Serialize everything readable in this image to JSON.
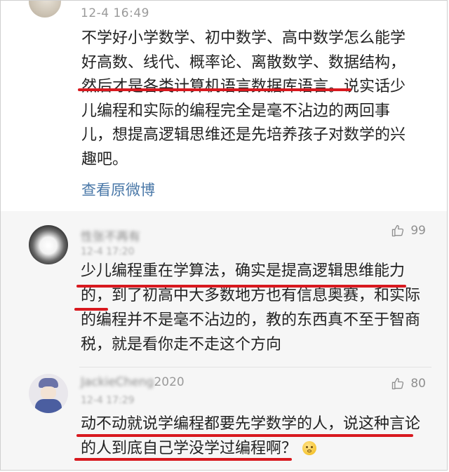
{
  "post": {
    "time": "12-4 16:49",
    "lines": [
      "不学好小学数学、初中数学、高中数学怎么能学",
      "好高数、线代、概率论、离散数学、数据结构，",
      "然后才是各类计算机语言数据库语言。说实话少",
      "儿编程和实际的编程完全是毫不沾边的两回事",
      "儿，想提高逻辑思维还是先培养孩子对数学的兴",
      "趣吧。"
    ],
    "view_original": "查看原微博"
  },
  "comments": [
    {
      "name": "性张不再有",
      "name_suffix": "",
      "time": "12-4 17:20",
      "likes": "99",
      "lines": [
        "少儿编程重在学算法，确实是提高逻辑思维能力",
        "的，到了初高中大多数地方也有信息奥赛，和实际",
        "的编程并不是毫不沾边的，教的东西真不至于智商",
        "税，就是看你走不走这个方向"
      ]
    },
    {
      "name": "JackieCheng",
      "name_suffix": "2020",
      "time": "12-4 17:29",
      "likes": "80",
      "lines": [
        "动不动就说学编程都要先学数学的人，说这种言论",
        "的人到底自己学没学过编程啊？"
      ]
    }
  ],
  "colors": {
    "text": "#222222",
    "meta": "#9a9a9a",
    "link": "#4a78a8",
    "underline": "#d8191f",
    "comment_bg": "#f6f6f6"
  },
  "icons": [
    "thumbs-up-icon",
    "blush-emoji-icon"
  ]
}
